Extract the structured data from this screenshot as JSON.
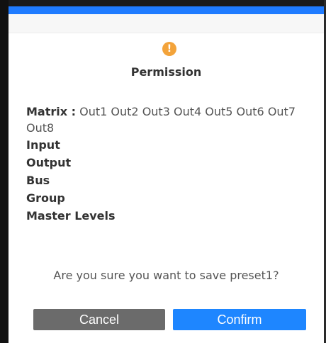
{
  "dialog": {
    "icon": "warning-icon",
    "icon_glyph": "!",
    "title": "Permission",
    "matrix_label": "Matrix :",
    "matrix_outputs": [
      "Out1",
      "Out2",
      "Out3",
      "Out4",
      "Out5",
      "Out6",
      "Out7",
      "Out8"
    ],
    "permissions": [
      "Input",
      "Output",
      "Bus",
      "Group",
      "Master Levels"
    ],
    "question": "Are you sure you want to save preset1?",
    "cancel_label": "Cancel",
    "confirm_label": "Confirm"
  },
  "colors": {
    "accent": "#1f7bff",
    "warning": "#f3a33a",
    "cancel_button": "#6b6b6b",
    "confirm_button": "#1e86ff"
  }
}
